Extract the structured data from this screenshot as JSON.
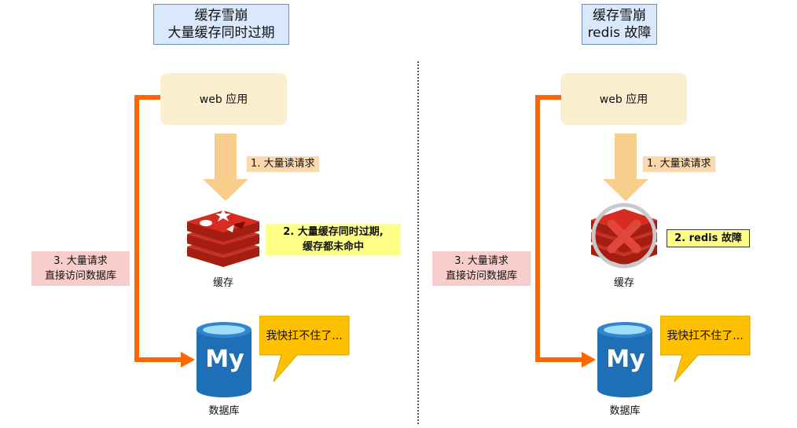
{
  "left": {
    "title_line1": "缓存雪崩",
    "title_line2": "大量缓存同时过期",
    "app_label": "web 应用",
    "step1": "1. 大量读请求",
    "step2_line1": "2. 大量缓存同时过期,",
    "step2_line2": "缓存都未命中",
    "step3_line1": "3. 大量请求",
    "step3_line2": "直接访问数据库",
    "cache_label": "缓存",
    "db_label": "数据库",
    "db_logo_text": "My",
    "callout": "我快扛不住了..."
  },
  "right": {
    "title_line1": "缓存雪崩",
    "title_line2": "redis 故障",
    "app_label": "web 应用",
    "step1": "1. 大量读请求",
    "step2": "2. redis 故障",
    "step3_line1": "3. 大量请求",
    "step3_line2": "直接访问数据库",
    "cache_label": "缓存",
    "db_label": "数据库",
    "db_logo_text": "My",
    "callout": "我快扛不住了..."
  },
  "colors": {
    "title_fill": "#dae8fc",
    "app_fill": "#fcefcf",
    "down_arrow": "#f9cd8c",
    "flow_line": "#ff6600",
    "redis_red": "#c7302a",
    "mysql_blue": "#1e6fb5",
    "callout_fill": "#ffc000",
    "error_red": "#e0463a"
  },
  "icons": {
    "cache": "redis-logo-icon",
    "database": "mysql-database-icon",
    "failure": "x-mark-icon"
  }
}
